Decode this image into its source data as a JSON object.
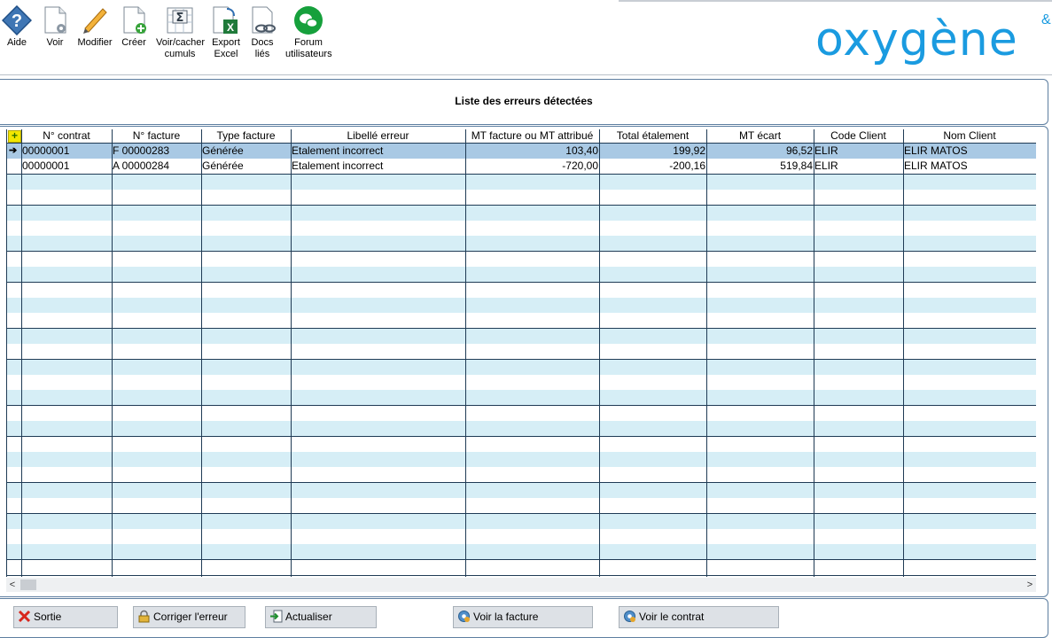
{
  "toolbar": {
    "aide": "Aide",
    "voir": "Voir",
    "modifier": "Modifier",
    "creer": "Créer",
    "voir_cacher": "Voir/cacher\ncumuls",
    "export_excel": "Export\nExcel",
    "docs_lies": "Docs\nliés",
    "forum": "Forum\nutilisateurs"
  },
  "logo": {
    "text": "oxygène",
    "sup": "&"
  },
  "title": "Liste des erreurs détectées",
  "columns": [
    "N° contrat",
    "N° facture",
    "Type facture",
    "Libellé erreur",
    "MT facture ou MT attribué",
    "Total étalement",
    "MT écart",
    "Code Client",
    "Nom Client"
  ],
  "rows": [
    [
      "00000001",
      "F 00000283",
      "Générée",
      "Etalement incorrect",
      "103,40",
      "199,92",
      "96,52",
      "ELIR",
      "ELIR MATOS"
    ],
    [
      "00000001",
      "A 00000284",
      "Générée",
      "Etalement incorrect",
      "-720,00",
      "-200,16",
      "519,84",
      "ELIR",
      "ELIR MATOS"
    ]
  ],
  "icons": {
    "row_pointer": "arrow-right-icon",
    "corner": "add-column-icon"
  },
  "footer": {
    "sortie": "Sortie",
    "corriger": "Corriger l'erreur",
    "actualiser": "Actualiser",
    "voir_facture": "Voir la facture",
    "voir_contrat": "Voir le contrat"
  },
  "colors": {
    "brand": "#1a9be0",
    "row_light": "#d6eef6",
    "row_selected": "#a9c9e4",
    "grid_line": "#1f3b55"
  }
}
